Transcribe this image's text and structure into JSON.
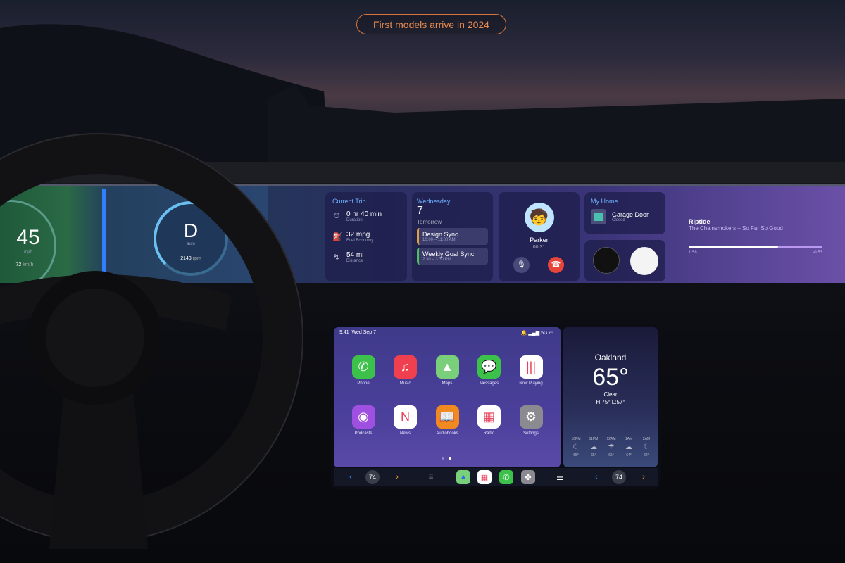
{
  "banner": {
    "label": "First models arrive in 2024",
    "color": "#d9763c"
  },
  "cluster": {
    "speed": "45",
    "speed_unit": "mph",
    "speed_kmh": "72",
    "speed_kmh_unit": "km/h",
    "gear": "D",
    "gear_mode": "auto",
    "rpm": "2143",
    "rpm_unit": "rpm"
  },
  "trip": {
    "title": "Current Trip",
    "items": [
      {
        "icon": "stopwatch-icon",
        "value": "0 hr 40 min",
        "label": "Duration"
      },
      {
        "icon": "fuel-pump-icon",
        "value": "32 mpg",
        "label": "Fuel Economy"
      },
      {
        "icon": "route-icon",
        "value": "54 mi",
        "label": "Distance"
      }
    ]
  },
  "calendar": {
    "day": "Wednesday",
    "date": "7",
    "next": "Tomorrow",
    "events": [
      {
        "title": "Design Sync",
        "time": "10:00 – 11:00 AM",
        "color": "#e0a040"
      },
      {
        "title": "Weekly Goal Sync",
        "time": "2:30 – 3:30 PM",
        "color": "#4cc060"
      }
    ]
  },
  "call": {
    "name": "Parker",
    "duration": "00:31"
  },
  "home": {
    "title": "My Home",
    "device": "Garage Door",
    "status": "Closed"
  },
  "music": {
    "title": "Riptide",
    "artist": "The Chainsmokers – So Far So Good",
    "elapsed": "1:58",
    "remaining": "-0:53",
    "progress": 0.67
  },
  "carplay": {
    "time": "9:41",
    "date": "Wed Sep 7",
    "network": "5G",
    "apps": [
      {
        "label": "Phone",
        "bg": "#3cc24a",
        "glyph": "✆"
      },
      {
        "label": "Music",
        "bg": "#f0404f",
        "glyph": "♫"
      },
      {
        "label": "Maps",
        "bg": "#7ad07a",
        "glyph": "▲"
      },
      {
        "label": "Messages",
        "bg": "#3cc24a",
        "glyph": "💬"
      },
      {
        "label": "Now Playing",
        "bg": "#ffffff",
        "glyph": "|||"
      },
      {
        "label": "Podcasts",
        "bg": "#a050e0",
        "glyph": "◉"
      },
      {
        "label": "News",
        "bg": "#ffffff",
        "glyph": "N"
      },
      {
        "label": "Audiobooks",
        "bg": "#f08a20",
        "glyph": "📖"
      },
      {
        "label": "Radio",
        "bg": "#ffffff",
        "glyph": "▦"
      },
      {
        "label": "Settings",
        "bg": "#8a8a90",
        "glyph": "⚙"
      }
    ],
    "page": 2,
    "pages": 2
  },
  "weather": {
    "city": "Oakland",
    "temp": "65°",
    "condition": "Clear",
    "hilo": "H:75°  L:57°",
    "hourly": [
      {
        "time": "10PM",
        "icon": "moon-icon",
        "temp": "65°"
      },
      {
        "time": "11PM",
        "icon": "cloud-moon-icon",
        "temp": "65°"
      },
      {
        "time": "12AM",
        "icon": "cloud-rain-icon",
        "temp": "65°"
      },
      {
        "time": "1AM",
        "icon": "cloud-moon-icon",
        "temp": "64°"
      },
      {
        "time": "2AM",
        "icon": "moon-icon",
        "temp": "64°"
      }
    ]
  },
  "dock": {
    "left_temp": "74",
    "right_temp": "74"
  }
}
